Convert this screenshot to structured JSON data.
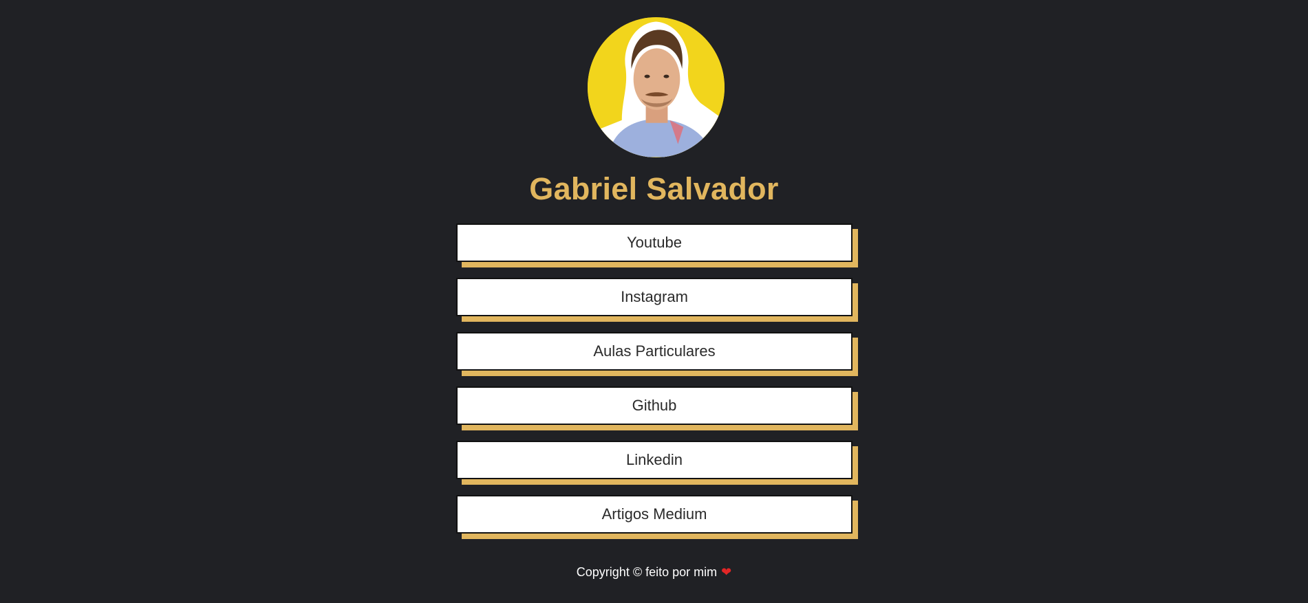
{
  "profile": {
    "name": "Gabriel Salvador",
    "avatar_icon": "profile-photo"
  },
  "links": [
    {
      "label": "Youtube"
    },
    {
      "label": "Instagram"
    },
    {
      "label": "Aulas Particulares"
    },
    {
      "label": "Github"
    },
    {
      "label": "Linkedin"
    },
    {
      "label": "Artigos Medium"
    }
  ],
  "footer": {
    "text": "Copyright © feito por mim",
    "heart": "❤"
  },
  "colors": {
    "background": "#202125",
    "accent": "#e1b65e",
    "avatar_bg": "#f2d51c",
    "button_bg": "#ffffff",
    "heart": "#e22626"
  }
}
